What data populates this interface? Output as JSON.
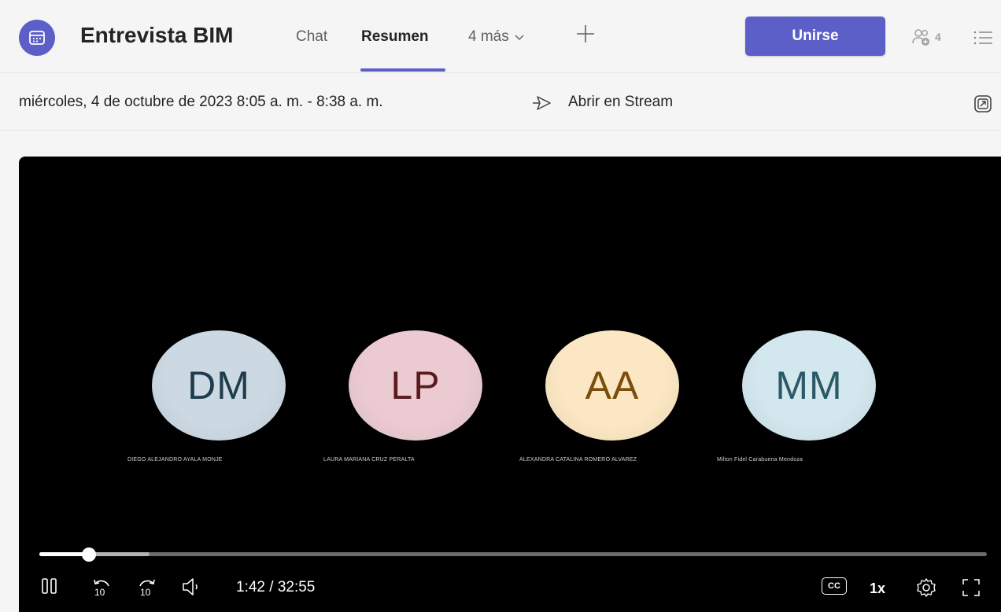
{
  "header": {
    "title": "Entrevista BIM",
    "tabs": [
      {
        "label": "Chat"
      },
      {
        "label": "Resumen"
      },
      {
        "label": "4 más"
      }
    ],
    "join_label": "Unirse",
    "participants_count": "4"
  },
  "info": {
    "date_range": "miércoles, 4 de octubre de 2023 8:05 a. m. - 8:38 a. m.",
    "open_stream": "Abrir en Stream"
  },
  "video": {
    "participants": [
      {
        "initials": "DM",
        "name": "DIEGO ALEJANDRO AYALA MONJE",
        "bg": "#ccd9e3",
        "fg": "#1f3c4d"
      },
      {
        "initials": "LP",
        "name": "LAURA MARIANA CRUZ PERALTA",
        "bg": "#ebcbd1",
        "fg": "#5a1b1f"
      },
      {
        "initials": "AA",
        "name": "ALEXANDRA CATALINA ROMERO ALVAREZ",
        "bg": "#fbe7c3",
        "fg": "#7a4e0b"
      },
      {
        "initials": "MM",
        "name": "Milton Fidel Carabuena Mendoza",
        "bg": "#d3e7ee",
        "fg": "#2b5966"
      }
    ],
    "progress": 0.052,
    "buffered": 0.116,
    "time_display": "1:42 / 32:55",
    "rewind_seconds": "10",
    "forward_seconds": "10",
    "captions_label": "CC",
    "speed": "1x"
  },
  "colors": {
    "accent": "#5b5fc7",
    "background": "#f5f5f5",
    "video_bg": "#000000"
  }
}
